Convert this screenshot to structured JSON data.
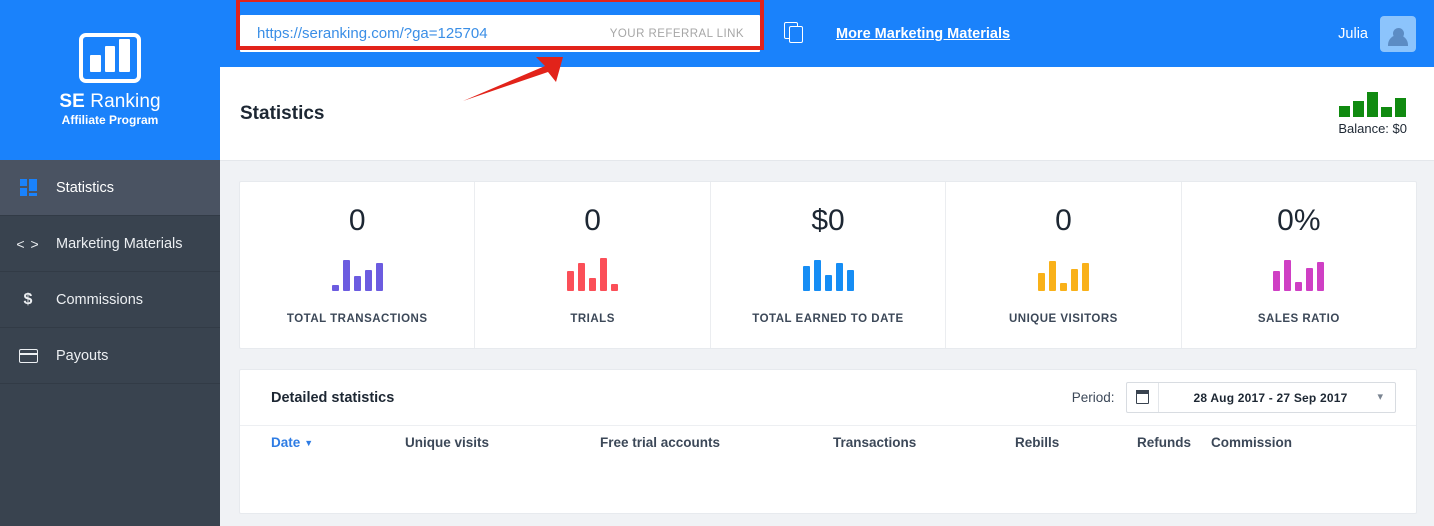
{
  "brand": {
    "name_bold": "SE",
    "name_light": "Ranking",
    "subtitle": "Affiliate Program",
    "header_blue": "#1a82fb",
    "sidebar_dark": "#39434f",
    "highlight_red": "#e2231a"
  },
  "sidebar": {
    "items": [
      {
        "label": "Statistics",
        "icon": "stats-icon",
        "active": true
      },
      {
        "label": "Marketing Materials",
        "icon": "code-brackets-icon",
        "active": false
      },
      {
        "label": "Commissions",
        "icon": "dollar-icon",
        "active": false
      },
      {
        "label": "Payouts",
        "icon": "credit-card-icon",
        "active": false
      }
    ]
  },
  "topbar": {
    "referral_link": "https://seranking.com/?ga=125704",
    "referral_link_tag": "YOUR REFERRAL LINK",
    "copy_icon": "copy-icon",
    "more_materials_label": "More Marketing Materials",
    "user_name": "Julia",
    "avatar_icon": "user-avatar-icon"
  },
  "page": {
    "title": "Statistics",
    "balance_label": "Balance: $0",
    "balance_spark_color": "#108a10",
    "balance_spark": [
      11,
      16,
      25,
      10,
      19
    ]
  },
  "stats": {
    "cards": [
      {
        "value": "0",
        "label": "TOTAL TRANSACTIONS",
        "color": "#6c5ce0",
        "spark": [
          6,
          31,
          15,
          21,
          28
        ]
      },
      {
        "value": "0",
        "label": "TRIALS",
        "color": "#fb4f58",
        "spark": [
          20,
          28,
          13,
          33,
          7
        ]
      },
      {
        "value": "$0",
        "label": "TOTAL EARNED TO DATE",
        "color": "#168df4",
        "spark": [
          25,
          31,
          16,
          28,
          21
        ]
      },
      {
        "value": "0",
        "label": "UNIQUE VISITORS",
        "color": "#f9b119",
        "spark": [
          18,
          30,
          8,
          22,
          28
        ]
      },
      {
        "value": "0%",
        "label": "SALES RATIO",
        "color": "#cf3fc4",
        "spark": [
          20,
          31,
          9,
          23,
          29
        ]
      }
    ]
  },
  "detailed": {
    "title": "Detailed statistics",
    "period_label": "Period:",
    "period_value": "28 Aug 2017 - 27 Sep 2017",
    "calendar_icon": "calendar-icon",
    "chevron_icon": "chevron-down-icon",
    "columns": [
      {
        "label": "Date",
        "sorted": true,
        "caret": "▼"
      },
      {
        "label": "Unique visits",
        "sorted": false,
        "caret": ""
      },
      {
        "label": "Free trial accounts",
        "sorted": false,
        "caret": ""
      },
      {
        "label": "Transactions",
        "sorted": false,
        "caret": ""
      },
      {
        "label": "Rebills",
        "sorted": false,
        "caret": ""
      },
      {
        "label": "Refunds",
        "sorted": false,
        "caret": ""
      },
      {
        "label": "Commission",
        "sorted": false,
        "caret": ""
      }
    ],
    "rows": []
  },
  "annotations": {
    "arrow_color": "#e2231a"
  }
}
